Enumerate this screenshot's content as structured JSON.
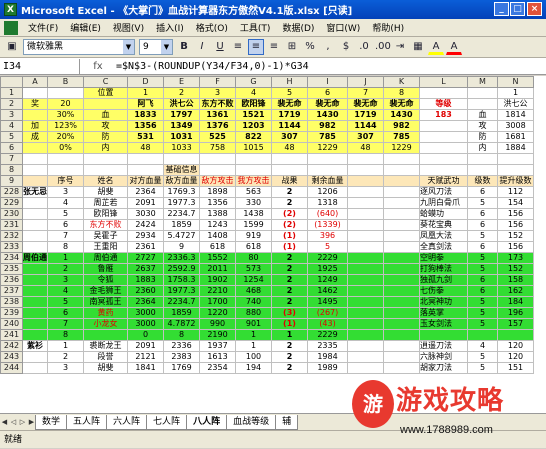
{
  "app": {
    "title": "Microsoft Excel - 《大掌门》血战计算器东方傲然V4.1版.xlsx [只读]",
    "icon": "X",
    "min": "_",
    "max": "□",
    "close": "×"
  },
  "menu": [
    "文件(F)",
    "编辑(E)",
    "视图(V)",
    "插入(I)",
    "格式(O)",
    "工具(T)",
    "数据(D)",
    "窗口(W)",
    "帮助(H)"
  ],
  "toolbar": {
    "font": "微软雅黑",
    "size": "9",
    "bold": "B",
    "italic": "I",
    "underline": "U",
    "align_left": "≡",
    "align_center": "≡",
    "align_right": "≡",
    "merge": "⊞",
    "percent": "%",
    "comma": ",",
    "currency": "$",
    "dec_up": ".0",
    "dec_down": ".00",
    "indent": "⇥",
    "border": "▦",
    "fill": "A",
    "fontcolor": "A"
  },
  "formula_bar": {
    "cell": "I34",
    "fx": "fx",
    "formula": "=$N$3-(ROUNDUP(Y34/F34,0)-1)*G34"
  },
  "columns": [
    "",
    "A",
    "B",
    "C",
    "D",
    "E",
    "F",
    "G",
    "H",
    "I",
    "J",
    "K",
    "L",
    "M",
    "N"
  ],
  "rows": {
    "r1": [
      "1",
      "",
      "",
      "位置",
      "1",
      "2",
      "3",
      "4",
      "5",
      "6",
      "7",
      "8",
      "",
      "",
      "1"
    ],
    "r2": [
      "2",
      "奖",
      "20",
      "",
      "阿飞",
      "洪七公",
      "东方不败",
      "欧阳锋",
      "裴无命",
      "裴无命",
      "裴无命",
      "裴无命",
      "等级",
      "",
      "洪七公"
    ],
    "r3": [
      "3",
      "",
      "30%",
      "血",
      "1833",
      "1797",
      "1361",
      "1521",
      "1719",
      "1430",
      "1719",
      "1430",
      "183",
      "血",
      "1814"
    ],
    "r4": [
      "4",
      "加",
      "123%",
      "攻",
      "1356",
      "1349",
      "1376",
      "1203",
      "1144",
      "982",
      "1144",
      "982",
      "",
      "攻",
      "3008"
    ],
    "r5": [
      "5",
      "成",
      "20%",
      "防",
      "531",
      "1031",
      "525",
      "822",
      "307",
      "785",
      "307",
      "785",
      "",
      "防",
      "1681"
    ],
    "r6": [
      "6",
      "",
      "0%",
      "内",
      "48",
      "1033",
      "758",
      "1015",
      "48",
      "1229",
      "48",
      "1229",
      "",
      "内",
      "1884"
    ],
    "r7": [
      "7",
      "",
      "",
      "",
      "",
      "",
      "",
      "",
      "",
      "",
      "",
      "",
      "",
      "",
      ""
    ],
    "r8": [
      "8",
      "",
      "",
      "",
      "",
      "基础信息",
      "",
      "",
      "",
      "",
      "",
      "",
      "",
      "",
      ""
    ],
    "r9": [
      "9",
      "",
      "序号",
      "姓名",
      "对方血量",
      "敌方血量",
      "敌方攻击",
      "我方攻击",
      "战果",
      "剩余血量",
      "",
      "",
      "天赋武功",
      "级数",
      "提升级数"
    ]
  },
  "data_rows": [
    {
      "rn": "228",
      "b": "3",
      "c": "胡斐",
      "d": "2364",
      "e": "1769.3",
      "f": "1898",
      "g": "563",
      "h": "2",
      "i": "1206",
      "l": "逐风刀法",
      "m": "6",
      "n": "112",
      "bg": "w",
      "side": "张无忌"
    },
    {
      "rn": "229",
      "b": "4",
      "c": "周芷若",
      "d": "2091",
      "e": "1977.3",
      "f": "1356",
      "g": "330",
      "h": "2",
      "i": "1318",
      "l": "九阴白骨爪",
      "m": "5",
      "n": "154",
      "bg": "w"
    },
    {
      "rn": "230",
      "b": "5",
      "c": "欧阳锋",
      "d": "3030",
      "e": "2234.7",
      "f": "1388",
      "g": "1438",
      "h": "(2)",
      "i": "(640)",
      "l": "蛤蟆功",
      "m": "6",
      "n": "156",
      "bg": "w",
      "redh": true
    },
    {
      "rn": "231",
      "b": "6",
      "c": "东方不败",
      "d": "2424",
      "e": "1859",
      "f": "1243",
      "g": "1599",
      "h": "(2)",
      "i": "(1339)",
      "l": "葵花宝典",
      "m": "6",
      "n": "156",
      "bg": "w",
      "redh": true,
      "redc": true
    },
    {
      "rn": "232",
      "b": "7",
      "c": "吴霍子",
      "d": "2934",
      "e": "5.4727",
      "f": "1408",
      "g": "919",
      "h": "(1)",
      "i": "396",
      "l": "凤凰大法",
      "m": "5",
      "n": "152",
      "bg": "w",
      "redh": true
    },
    {
      "rn": "233",
      "b": "8",
      "c": "王重阳",
      "d": "2361",
      "e": "9",
      "f": "618",
      "g": "618",
      "h": "(1)",
      "i": "5",
      "l": "全真剑法",
      "m": "6",
      "n": "156",
      "bg": "w",
      "redh": true
    },
    {
      "rn": "234",
      "b": "1",
      "c": "周伯通",
      "d": "2727",
      "e": "2336.3",
      "f": "1552",
      "g": "80",
      "h": "2",
      "i": "2229",
      "l": "空明拳",
      "m": "5",
      "n": "173",
      "bg": "g",
      "side": "周伯通"
    },
    {
      "rn": "235",
      "b": "2",
      "c": "鲁雁",
      "d": "2637",
      "e": "2592.9",
      "f": "2011",
      "g": "573",
      "h": "2",
      "i": "1925",
      "l": "打狗棒法",
      "m": "5",
      "n": "152",
      "bg": "g"
    },
    {
      "rn": "236",
      "b": "3",
      "c": "令狐",
      "d": "1883",
      "e": "1758.3",
      "f": "1902",
      "g": "1254",
      "h": "2",
      "i": "1249",
      "l": "独孤九剑",
      "m": "6",
      "n": "158",
      "bg": "g"
    },
    {
      "rn": "237",
      "b": "4",
      "c": "金毛狮王",
      "d": "2360",
      "e": "1977.3",
      "f": "2210",
      "g": "468",
      "h": "2",
      "i": "1462",
      "l": "七伤拳",
      "m": "6",
      "n": "162",
      "bg": "g"
    },
    {
      "rn": "238",
      "b": "5",
      "c": "南冥孤王",
      "d": "2364",
      "e": "2234.7",
      "f": "1700",
      "g": "740",
      "h": "2",
      "i": "1495",
      "l": "北冥神功",
      "m": "5",
      "n": "184",
      "bg": "g"
    },
    {
      "rn": "239",
      "b": "6",
      "c": "黄药",
      "d": "3000",
      "e": "1859",
      "f": "1220",
      "g": "880",
      "h": "(3)",
      "i": "(267)",
      "l": "落英掌",
      "m": "5",
      "n": "196",
      "bg": "g",
      "redh": true,
      "redc": true
    },
    {
      "rn": "240",
      "b": "7",
      "c": "小龙女",
      "d": "3000",
      "e": "4.7872",
      "f": "990",
      "g": "901",
      "h": "(1)",
      "i": "(43)",
      "l": "玉女剑法",
      "m": "5",
      "n": "157",
      "bg": "g",
      "redh": true,
      "redc": true
    },
    {
      "rn": "241",
      "b": "8",
      "c": "",
      "d": "0",
      "e": "8",
      "f": "2190",
      "g": "1",
      "h": "1",
      "i": "2229",
      "l": "",
      "m": "",
      "n": "",
      "bg": "g"
    },
    {
      "rn": "242",
      "b": "1",
      "c": "裘断龙王",
      "d": "2091",
      "e": "2336",
      "f": "1937",
      "g": "1",
      "h": "2",
      "i": "2335",
      "l": "逍遥刀法",
      "m": "4",
      "n": "120",
      "bg": "w",
      "side": "紫衫"
    },
    {
      "rn": "243",
      "b": "2",
      "c": "段誉",
      "d": "2121",
      "e": "2383",
      "f": "1613",
      "g": "100",
      "h": "2",
      "i": "1984",
      "l": "六脉神剑",
      "m": "5",
      "n": "120",
      "bg": "w"
    },
    {
      "rn": "244",
      "b": "3",
      "c": "胡斐",
      "d": "1841",
      "e": "1769",
      "f": "2354",
      "g": "194",
      "h": "2",
      "i": "1989",
      "l": "胡家刀法",
      "m": "5",
      "n": "151",
      "bg": "w"
    }
  ],
  "tabs": [
    "数学",
    "五人阵",
    "六人阵",
    "七人阵",
    "八人阵",
    "血战等级",
    "辅"
  ],
  "status": "就绪",
  "watermark": {
    "icon": "游",
    "title": "游戏攻略",
    "url": "www.1788989.com"
  }
}
